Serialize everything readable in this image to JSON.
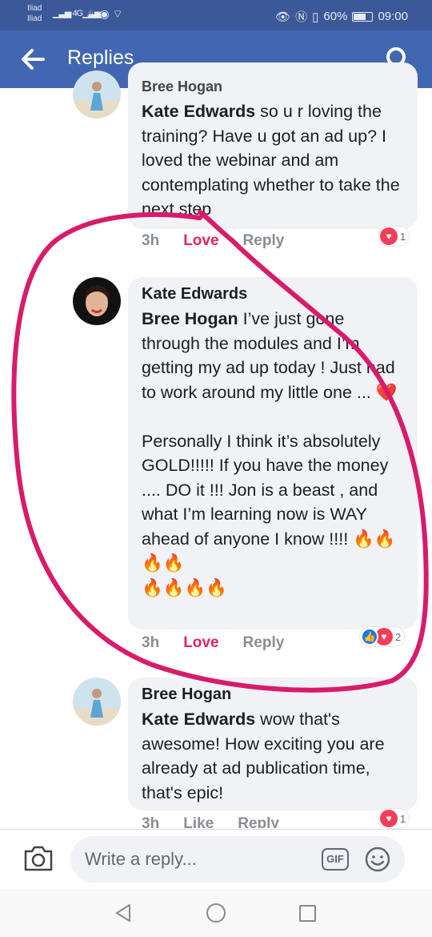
{
  "status_bar": {
    "carrier_1": "Iliad",
    "carrier_2": "Iliad",
    "network_label": "4G",
    "battery": "60%",
    "time": "09:00"
  },
  "header": {
    "title": "Replies",
    "back_icon": "arrow-left-icon",
    "search_icon": "search-icon"
  },
  "comments": [
    {
      "author": "Bree Hogan",
      "mention": "Kate Edwards",
      "text": " so u r loving the training? Have u got an ad up? I loved the webinar and am contemplating whether to take the next step",
      "time": "3h",
      "action_1": "Love",
      "action_2": "Reply",
      "reaction_count": "1"
    },
    {
      "author": "Kate Edwards",
      "mention": "Bree Hogan",
      "text": " I’ve just gone through the modules and I’m getting my ad up today ! Just had to work around my little one ... ❤️\n\nPersonally I think it’s absolutely GOLD!!!!! If you have the money .... DO it !!! Jon is a beast , and what I’m learning now is WAY ahead of anyone I know !!!! 🔥🔥🔥🔥\n🔥🔥🔥🔥",
      "time": "3h",
      "action_1": "Love",
      "action_2": "Reply",
      "reaction_count": "2"
    },
    {
      "author": "Bree Hogan",
      "mention": "Kate Edwards",
      "text": " wow that's awesome! How exciting you are already at ad publication time, that's epic!",
      "time": "3h",
      "action_1": "Like",
      "action_2": "Reply",
      "reaction_count": "1"
    }
  ],
  "composer": {
    "placeholder": "Write a reply...",
    "gif_label": "GIF"
  },
  "colors": {
    "header": "#4267b2",
    "status_bar": "#3b5998",
    "love": "#e5245e",
    "bubble": "#f0f2f5",
    "annotation_ring": "#d81b6a"
  }
}
